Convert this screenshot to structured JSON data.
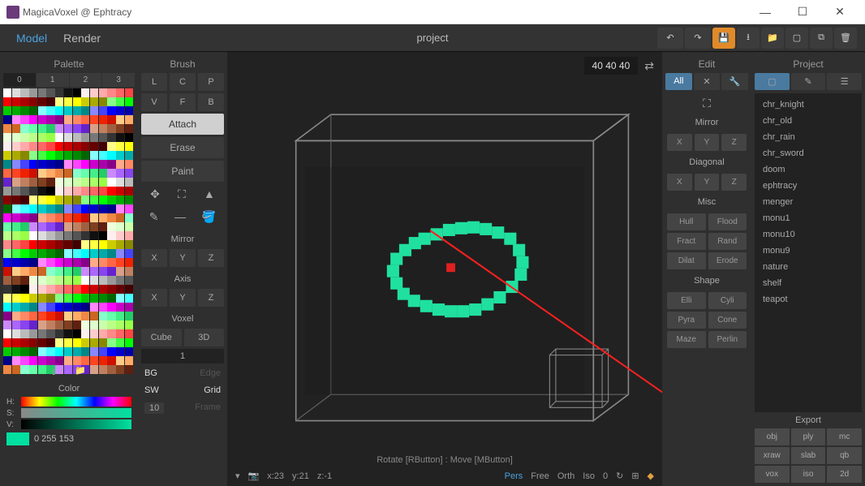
{
  "window": {
    "title": "MagicaVoxel @ Ephtracy"
  },
  "menu": {
    "model": "Model",
    "render": "Render",
    "project_name": "project"
  },
  "palette": {
    "title": "Palette",
    "tabs": [
      "0",
      "1",
      "2",
      "3"
    ],
    "color_label": "Color",
    "h": "H:",
    "s": "S:",
    "v": "V:",
    "rgb": "0  255  153"
  },
  "brush": {
    "title": "Brush",
    "row1": [
      "L",
      "C",
      "P"
    ],
    "row2": [
      "V",
      "F",
      "B"
    ],
    "modes": [
      "Attach",
      "Erase",
      "Paint"
    ],
    "mirror": "Mirror",
    "mirror_axes": [
      "X",
      "Y",
      "Z"
    ],
    "axis": "Axis",
    "axis_axes": [
      "X",
      "Y",
      "Z"
    ],
    "voxel": "Voxel",
    "voxel_btns": [
      "Cube",
      "3D"
    ],
    "voxel_num": "1",
    "bg": "BG",
    "edge": "Edge",
    "sw": "SW",
    "grid": "Grid",
    "ten": "10",
    "frame": "Frame"
  },
  "viewport": {
    "dims": "40  40  40",
    "coords_x": "x:23",
    "coords_y": "y:21",
    "coords_z": "z:-1",
    "pers": "Pers",
    "free": "Free",
    "orth": "Orth",
    "iso": "Iso",
    "zero": "0",
    "status": "Rotate [RButton] : Move [MButton]"
  },
  "edit": {
    "title": "Edit",
    "all": "All",
    "mirror": "Mirror",
    "mirror_axes": [
      "X",
      "Y",
      "Z"
    ],
    "diagonal": "Diagonal",
    "diag_axes": [
      "X",
      "Y",
      "Z"
    ],
    "misc": "Misc",
    "misc_btns": [
      [
        "Hull",
        "Flood"
      ],
      [
        "Fract",
        "Rand"
      ],
      [
        "Dilat",
        "Erode"
      ]
    ],
    "shape": "Shape",
    "shape_btns": [
      [
        "Elli",
        "Cyli"
      ],
      [
        "Pyra",
        "Cone"
      ],
      [
        "Maze",
        "Perlin"
      ]
    ]
  },
  "project": {
    "title": "Project",
    "items": [
      "chr_knight",
      "chr_old",
      "chr_rain",
      "chr_sword",
      "doom",
      "ephtracy",
      "menger",
      "monu1",
      "monu10",
      "monu9",
      "nature",
      "shelf",
      "teapot"
    ],
    "export": "Export",
    "export_btns": [
      "obj",
      "ply",
      "mc",
      "xraw",
      "slab",
      "qb",
      "vox",
      "iso",
      "2d"
    ]
  }
}
